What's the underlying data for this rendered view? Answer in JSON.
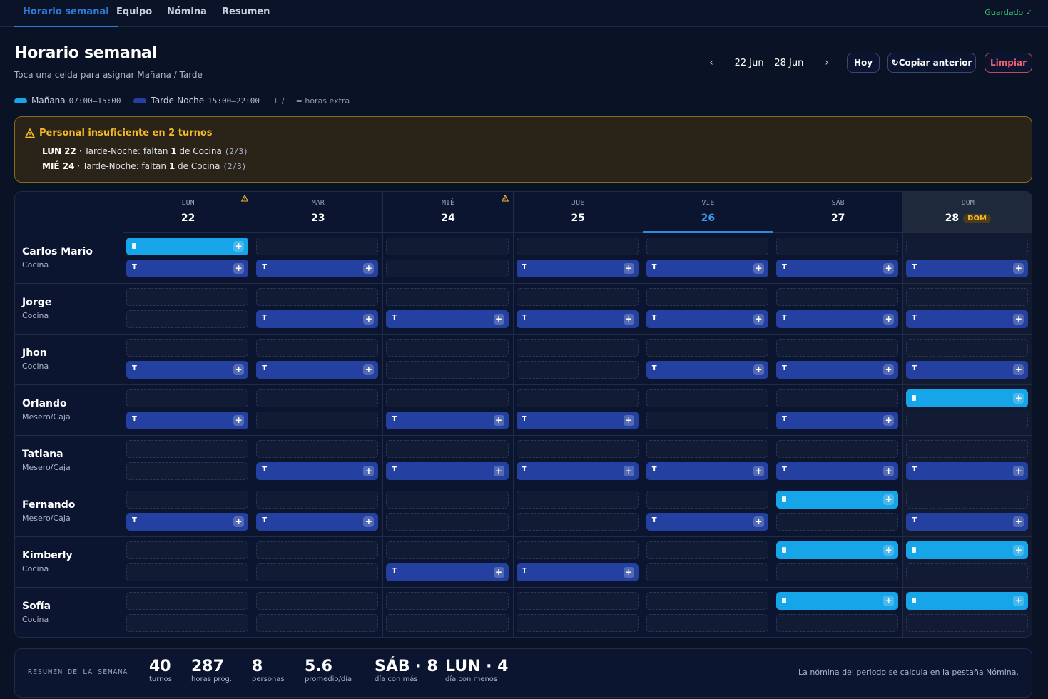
{
  "nav": {
    "tabs": [
      {
        "label": "Horario semanal",
        "active": true
      },
      {
        "label": "Equipo",
        "active": false
      },
      {
        "label": "Nómina",
        "active": false
      },
      {
        "label": "Resumen",
        "active": false
      }
    ],
    "status": "Guardado ✓"
  },
  "header": {
    "title": "Horario semanal",
    "subtitle": "Toca una celda para asignar Mañana / Tarde",
    "week_range": "22  Jun  –  28  Jun",
    "prev_icon": "‹",
    "next_icon": "›",
    "today_button": "Hoy",
    "copy_button": "↻Copiar anterior",
    "clear_button": "Limpiar"
  },
  "legend": {
    "morning_label": "Mañana",
    "morning_time": "07:00–15:00",
    "morning_color": "#16a5e8",
    "evening_label": "Tarde-Noche",
    "evening_time": "15:00–22:00",
    "evening_color": "#2440a0",
    "extra_note": "+ / − = horas extra"
  },
  "alert": {
    "icon": "warning-icon",
    "title": "Personal insuficiente en 2 turnos",
    "lines": [
      {
        "day": "LUN 22",
        "text_a": " · Tarde-Noche: faltan ",
        "count": "1",
        "text_b": " de Cocina ",
        "ratio": "(2/3)"
      },
      {
        "day": "MIÉ 24",
        "text_a": " · Tarde-Noche: faltan ",
        "count": "1",
        "text_b": " de Cocina ",
        "ratio": "(2/3)"
      }
    ]
  },
  "days": [
    {
      "abbr": "LUN",
      "num": "22",
      "warn": true
    },
    {
      "abbr": "MAR",
      "num": "23",
      "warn": false
    },
    {
      "abbr": "MIÉ",
      "num": "24",
      "warn": true
    },
    {
      "abbr": "JUE",
      "num": "25",
      "warn": false
    },
    {
      "abbr": "VIE",
      "num": "26",
      "warn": false,
      "today": true
    },
    {
      "abbr": "SÁB",
      "num": "27",
      "warn": false
    },
    {
      "abbr": "DOM",
      "num": "28",
      "warn": false,
      "badge": "DOM"
    }
  ],
  "shift_letters": {
    "M": "M",
    "T": "T"
  },
  "employees": [
    {
      "name": "Carlos Mario",
      "role": "Cocina",
      "shifts": [
        "MT",
        "T",
        "",
        "T",
        "T",
        "T",
        "T"
      ]
    },
    {
      "name": "Jorge",
      "role": "Cocina",
      "shifts": [
        "",
        "T",
        "T",
        "T",
        "T",
        "T",
        "T"
      ]
    },
    {
      "name": "Jhon",
      "role": "Cocina",
      "shifts": [
        "T",
        "T",
        "",
        "",
        "T",
        "T",
        "T"
      ]
    },
    {
      "name": "Orlando",
      "role": "Mesero/Caja",
      "shifts": [
        "T",
        "",
        "T",
        "T",
        "",
        "T",
        "M"
      ]
    },
    {
      "name": "Tatiana",
      "role": "Mesero/Caja",
      "shifts": [
        "",
        "T",
        "T",
        "T",
        "T",
        "T",
        "T"
      ]
    },
    {
      "name": "Fernando",
      "role": "Mesero/Caja",
      "shifts": [
        "T",
        "T",
        "",
        "",
        "T",
        "M",
        "T"
      ]
    },
    {
      "name": "Kimberly",
      "role": "Cocina",
      "shifts": [
        "",
        "",
        "T",
        "T",
        "",
        "M",
        "M"
      ]
    },
    {
      "name": "Sofía",
      "role": "Cocina",
      "shifts": [
        "",
        "",
        "",
        "",
        "",
        "M",
        "M"
      ]
    }
  ],
  "summary": {
    "title": "RESUMEN DE LA SEMANA",
    "stats": [
      {
        "value": "40",
        "label": "turnos"
      },
      {
        "value": "287",
        "label": "horas prog."
      },
      {
        "value": "8",
        "label": "personas"
      },
      {
        "value": "5.6",
        "label": "promedio/día"
      },
      {
        "value": "SÁB · 8",
        "label": "día con más"
      },
      {
        "value": "LUN · 4",
        "label": "día con menos"
      }
    ],
    "note": "La nómina del periodo se calcula en la pestaña Nómina."
  }
}
